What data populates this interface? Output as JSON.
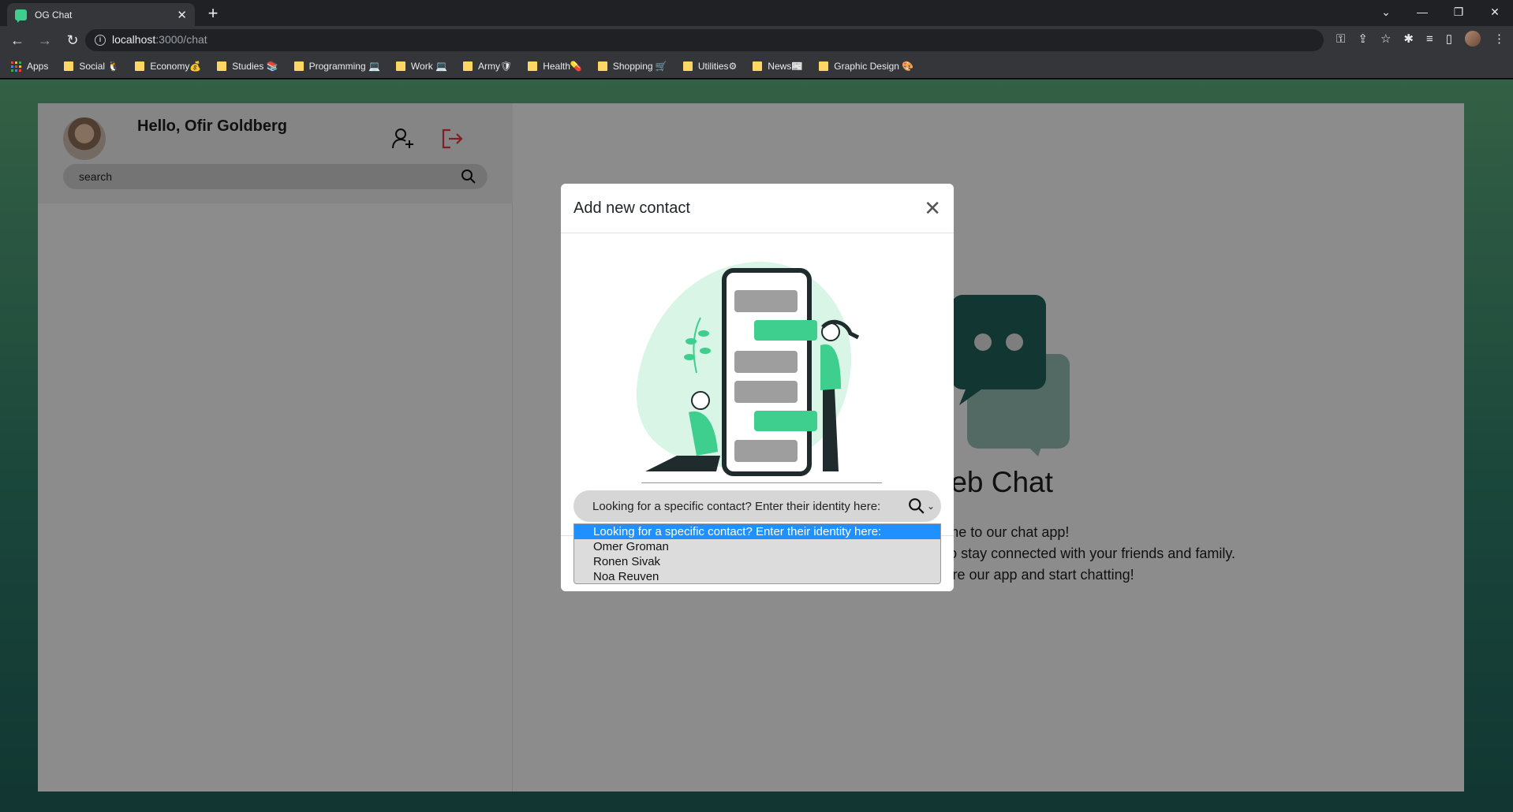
{
  "browser": {
    "tab_title": "OG Chat",
    "url_host": "localhost",
    "url_path": ":3000/chat",
    "bookmarks": [
      {
        "label": "Apps"
      },
      {
        "label": "Social 🐧"
      },
      {
        "label": "Economy💰"
      },
      {
        "label": "Studies 📚"
      },
      {
        "label": "Programming 💻"
      },
      {
        "label": "Work 💻"
      },
      {
        "label": "Army🛡"
      },
      {
        "label": "Health💊"
      },
      {
        "label": "Shopping 🛒"
      },
      {
        "label": "Utilities⚙"
      },
      {
        "label": "News📰"
      },
      {
        "label": "Graphic Design 🎨"
      }
    ]
  },
  "sidebar": {
    "greeting": "Hello, Ofir Goldberg",
    "search_placeholder": "search"
  },
  "main": {
    "title": "Web Chat",
    "lines": [
      "Welcome to our chat app!",
      "Thank you for choosing our app to stay connected with your friends and family.",
      "Feel free to explore our app and start chatting!"
    ]
  },
  "modal": {
    "title": "Add new contact",
    "select_value": "Looking for a specific contact? Enter their identity here:",
    "options": [
      {
        "label": "Looking for a specific contact? Enter their identity here:",
        "selected": true
      },
      {
        "label": "Omer Groman",
        "selected": false
      },
      {
        "label": "Ronen Sivak",
        "selected": false
      },
      {
        "label": "Noa Reuven",
        "selected": false
      }
    ]
  },
  "colors": {
    "accent_green": "#3ecf8e",
    "logout_red": "#dc3545",
    "selected_blue": "#1e90ff",
    "logo_teal": "#1f5e57"
  }
}
